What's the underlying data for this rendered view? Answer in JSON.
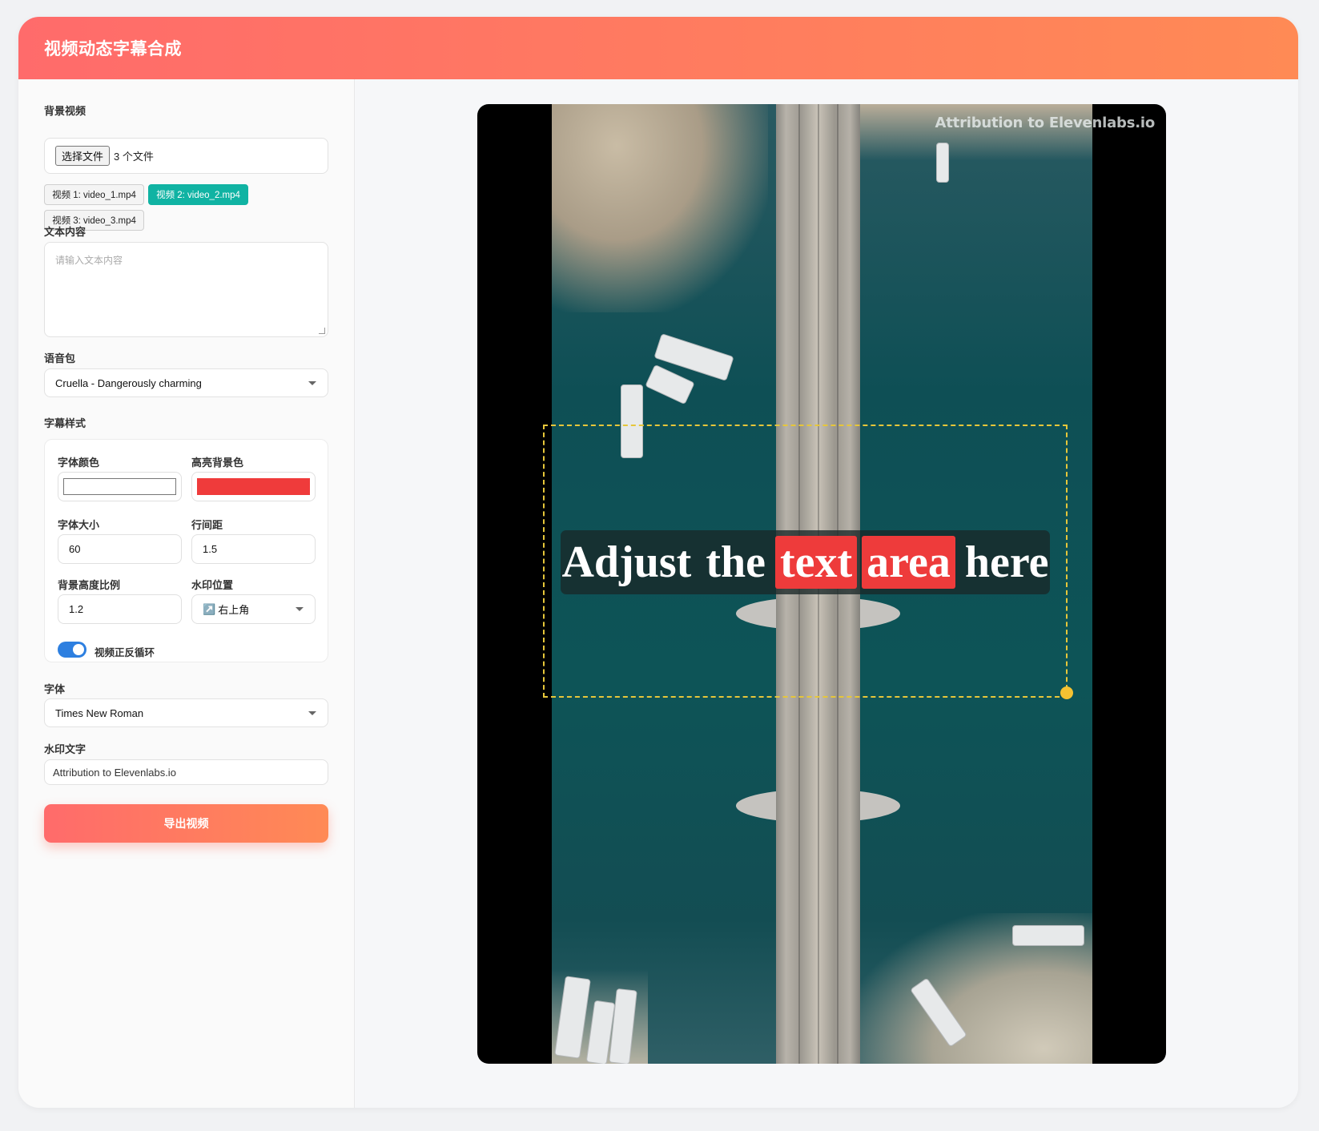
{
  "app": {
    "title": "视频动态字幕合成"
  },
  "sidebar": {
    "bg_video": {
      "label": "背景视频",
      "choose_button": "选择文件",
      "file_count": "3 个文件",
      "videos": [
        {
          "label": "视频 1: video_1.mp4",
          "active": false
        },
        {
          "label": "视频 2: video_2.mp4",
          "active": true
        },
        {
          "label": "视频 3: video_3.mp4",
          "active": false
        }
      ]
    },
    "text": {
      "label": "文本内容",
      "placeholder": "请输入文本内容",
      "value": ""
    },
    "voice": {
      "label": "语音包",
      "selected": "Cruella - Dangerously charming"
    },
    "subtitle_style": {
      "label": "字幕样式",
      "font_color": {
        "label": "字体颜色",
        "value": "#ffffff"
      },
      "highlight_bg": {
        "label": "高亮背景色",
        "value": "#ef3b3b"
      },
      "font_size": {
        "label": "字体大小",
        "value": "60"
      },
      "line_height": {
        "label": "行间距",
        "value": "1.5"
      },
      "bg_height_ratio": {
        "label": "背景高度比例",
        "value": "1.2"
      },
      "watermark_position": {
        "label": "水印位置",
        "icon": "↗️",
        "selected": "右上角"
      },
      "loop": {
        "label": "视频正反循环",
        "enabled": true
      }
    },
    "font": {
      "label": "字体",
      "selected": "Times New Roman"
    },
    "watermark": {
      "label": "水印文字",
      "value": "Attribution to Elevenlabs.io"
    },
    "export_button": "导出视频"
  },
  "preview": {
    "watermark_text": "Attribution to Elevenlabs.io",
    "subtitle_words": [
      {
        "text": "Adjust",
        "highlight": false
      },
      {
        "text": "the",
        "highlight": false
      },
      {
        "text": "text",
        "highlight": true
      },
      {
        "text": "area",
        "highlight": true
      },
      {
        "text": "here",
        "highlight": false
      }
    ]
  },
  "colors": {
    "accent_start": "#ff6b6b",
    "accent_end": "#ff8a55",
    "active_chip": "#10b3a3",
    "toggle_on": "#2d7fe0",
    "selection_border": "#e6c63a"
  }
}
